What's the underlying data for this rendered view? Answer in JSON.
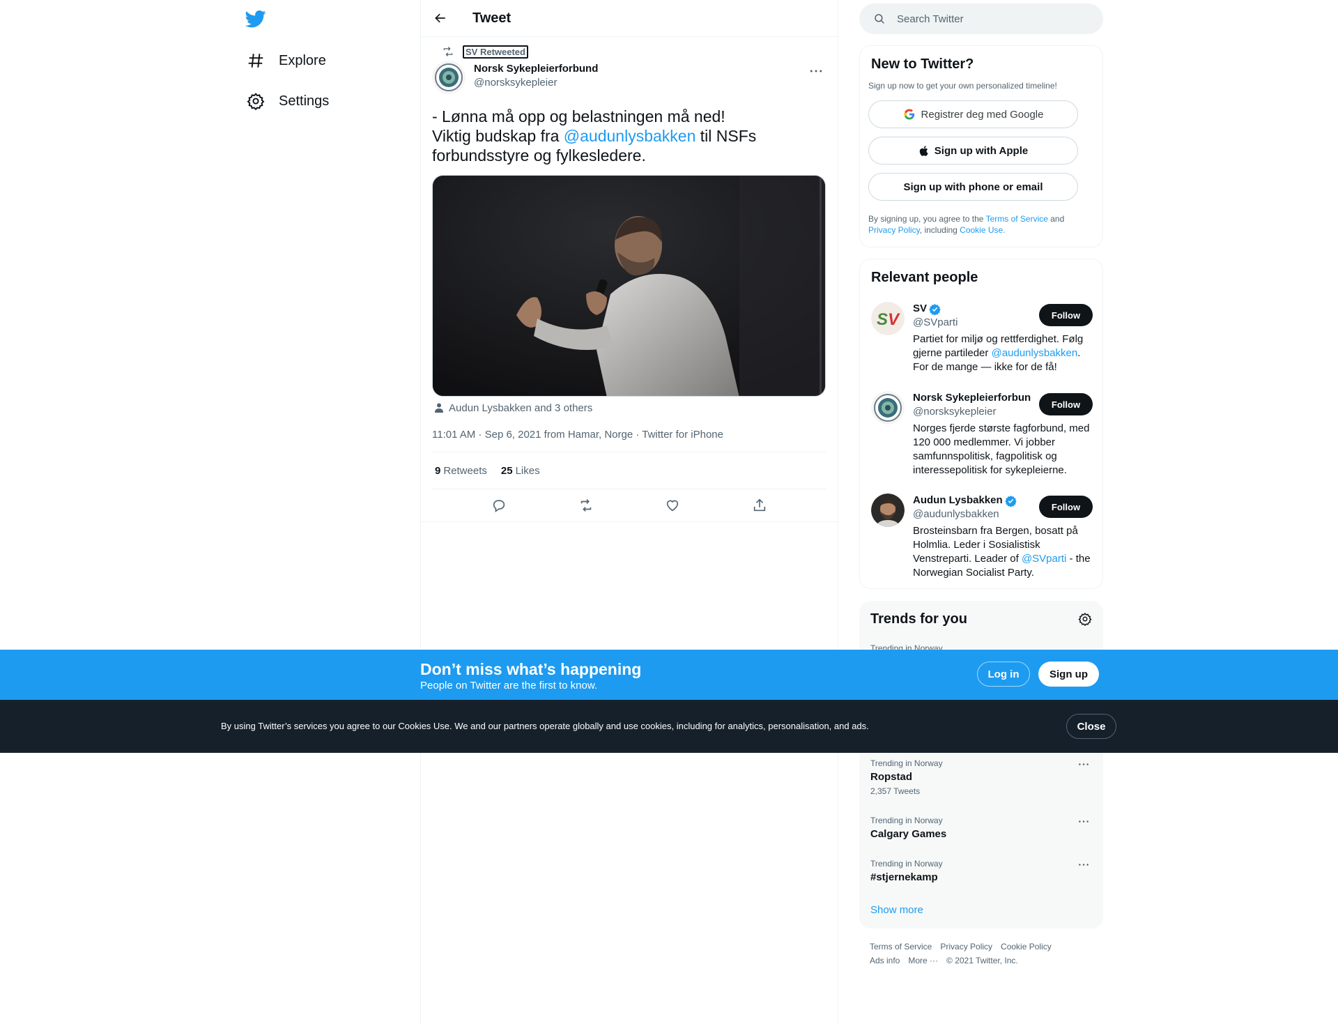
{
  "nav": {
    "explore_label": "Explore",
    "settings_label": "Settings"
  },
  "header": {
    "title": "Tweet"
  },
  "tweet": {
    "retweeted_by": "SV Retweeted",
    "author_name": "Norsk Sykepleierforbund",
    "author_handle": "@norsksykepleier",
    "text_line1": "- Lønna må opp og belastningen må ned!",
    "text_line2_pre": "Viktig budskap fra ",
    "text_mention": "@audunlysbakken",
    "text_line2_post": " til NSFs",
    "text_line3": "forbundsstyre og fylkesledere.",
    "tagged": "Audun Lysbakken and 3 others",
    "timestamp": "11:01 AM · Sep 6, 2021 from Hamar, Norge · Twitter for iPhone",
    "retweets_count": "9",
    "retweets_label": "Retweets",
    "likes_count": "25",
    "likes_label": "Likes"
  },
  "search": {
    "placeholder": "Search Twitter"
  },
  "new_to_twitter": {
    "title": "New to Twitter?",
    "subtitle": "Sign up now to get your own personalized timeline!",
    "google_label": "Registrer deg med Google",
    "apple_label": "Sign up with Apple",
    "phone_label": "Sign up with phone or email",
    "legal_pre": "By signing up, you agree to the ",
    "legal_terms": "Terms of Service",
    "legal_and": " and",
    "legal_privacy": "Privacy Policy",
    "legal_including": ", including ",
    "legal_cookie": "Cookie Use."
  },
  "relevant_people": {
    "title": "Relevant people",
    "follow_label": "Follow",
    "people": [
      {
        "name": "SV",
        "handle": "@SVparti",
        "bio_pre": "Partiet for miljø og rettferdighet. Følg gjerne partileder ",
        "bio_mention": "@audunlysbakken",
        "bio_post": ". For de mange — ikke for de få!",
        "avatar_text": "SV"
      },
      {
        "name": "Norsk Sykepleierforbund",
        "handle": "@norsksykepleier",
        "bio": "Norges fjerde største fagforbund, med 120 000 medlemmer. Vi jobber samfunnspolitisk, fagpolitisk og interessepolitisk for sykepleierne."
      },
      {
        "name": "Audun Lysbakken",
        "handle": "@audunlysbakken",
        "bio_pre": "Brosteinsbarn fra Bergen, bosatt på Holmlia. Leder i Sosialistisk Venstreparti. Leader of ",
        "bio_mention": "@SVparti",
        "bio_post": " - the Norwegian Socialist Party."
      }
    ]
  },
  "trends": {
    "title": "Trends for you",
    "items": [
      {
        "context": "Trending in Norway",
        "name": "",
        "count": ""
      },
      {
        "context": "Trending in Norway",
        "name": "Ropstad",
        "count": "2,357 Tweets"
      },
      {
        "context": "Trending in Norway",
        "name": "Calgary Games",
        "count": ""
      },
      {
        "context": "Trending in Norway",
        "name": "#stjernekamp",
        "count": ""
      }
    ],
    "show_more": "Show more"
  },
  "footer": {
    "terms": "Terms of Service",
    "privacy": "Privacy Policy",
    "cookie": "Cookie Policy",
    "ads": "Ads info",
    "more": "More ···",
    "copyright": "© 2021 Twitter, Inc."
  },
  "banner": {
    "title": "Don’t miss what’s happening",
    "subtitle": "People on Twitter are the first to know.",
    "login_label": "Log in",
    "signup_label": "Sign up"
  },
  "cookies": {
    "text": "By using Twitter’s services you agree to our Cookies Use. We and our partners operate globally and use cookies, including for analytics, personalisation, and ads.",
    "close_label": "Close"
  },
  "colors": {
    "accent": "#1d9bf0",
    "text_primary": "#0f1419",
    "text_secondary": "#536471",
    "cookie_bar": "#15202b"
  }
}
